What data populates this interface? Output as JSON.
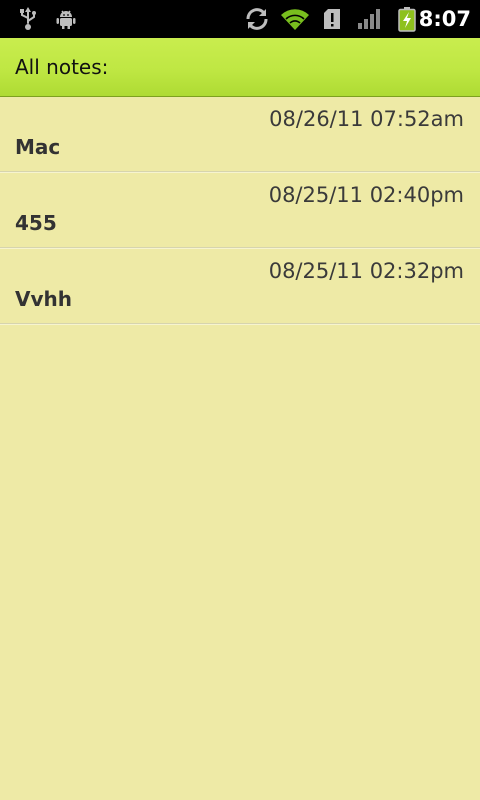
{
  "status_bar": {
    "time": "8:07",
    "icons": [
      "usb-icon",
      "android-debug-icon",
      "sync-icon",
      "wifi-icon",
      "sd-card-alert-icon",
      "signal-icon",
      "battery-charging-icon"
    ]
  },
  "header": {
    "title": "All notes:"
  },
  "notes": [
    {
      "date": "08/26/11 07:52am",
      "title": "Mac"
    },
    {
      "date": "08/25/11 02:40pm",
      "title": "455"
    },
    {
      "date": "08/25/11 02:32pm",
      "title": "Vvhh"
    }
  ],
  "colors": {
    "background": "#eeeaa6",
    "header": "#bfe743",
    "status_bar": "#000000"
  }
}
